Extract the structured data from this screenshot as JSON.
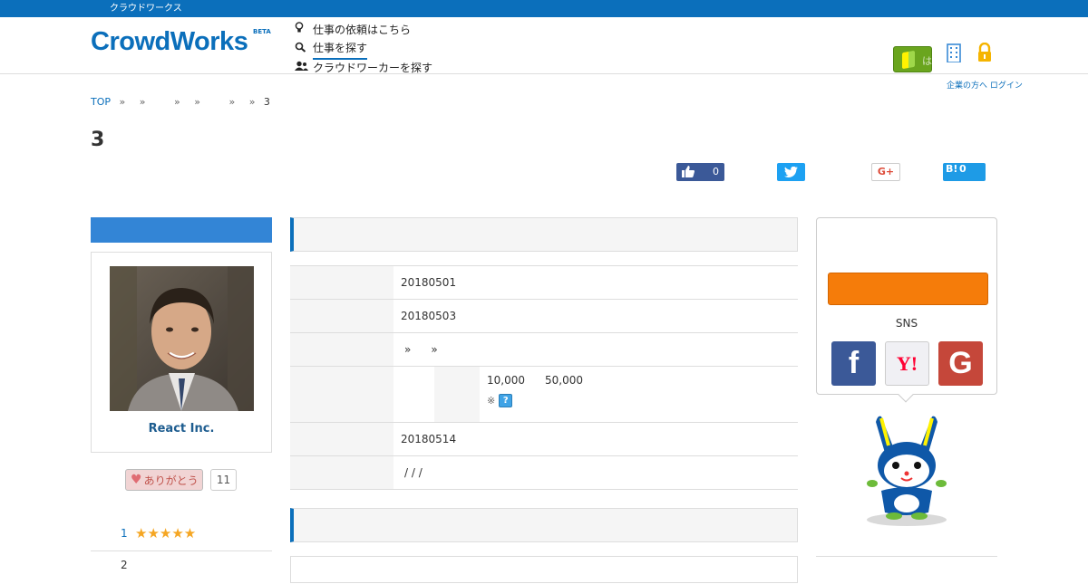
{
  "topbar": {
    "text": "クラウドワークス"
  },
  "header": {
    "logo": "CrowdWorks",
    "logo_badge": "BETA",
    "nav": [
      {
        "label": "仕事の依頼はこちら",
        "icon": "lightbulb-icon"
      },
      {
        "label": "仕事を探す",
        "icon": "search-icon"
      },
      {
        "label": "クラウドワーカーを探す",
        "icon": "users-icon"
      }
    ],
    "beginner_label": "はじめての方へ",
    "links": "企業の方へ ログイン"
  },
  "breadcrumb": {
    "top": "TOP",
    "sep": "»",
    "last": "3"
  },
  "page_title": "3",
  "share": {
    "facebook_count": "0",
    "hatena_label": "B!",
    "hatena_count": "0",
    "gplus_label": "G+"
  },
  "left": {
    "company": "React Inc.",
    "thanks_label": "ありがとう",
    "thanks_count": "11",
    "ratings": [
      {
        "num": "1",
        "stars": "★★★★★"
      },
      {
        "num": "2",
        "stars": ""
      }
    ]
  },
  "detail": {
    "row1": "20180501",
    "row2": "20180503",
    "row3_a": "»",
    "row3_b": "»",
    "budget_min": "10,000",
    "budget_max": "50,000",
    "note_mark": "※",
    "help_icon": "?",
    "row5": "20180514",
    "row6": "/ / /"
  },
  "right": {
    "sns_label": "SNS",
    "facebook": "f",
    "yahoo": "Y!",
    "google": "G"
  },
  "colors": {
    "brand_blue": "#0b6fbb",
    "cta_orange": "#f57c0a"
  }
}
